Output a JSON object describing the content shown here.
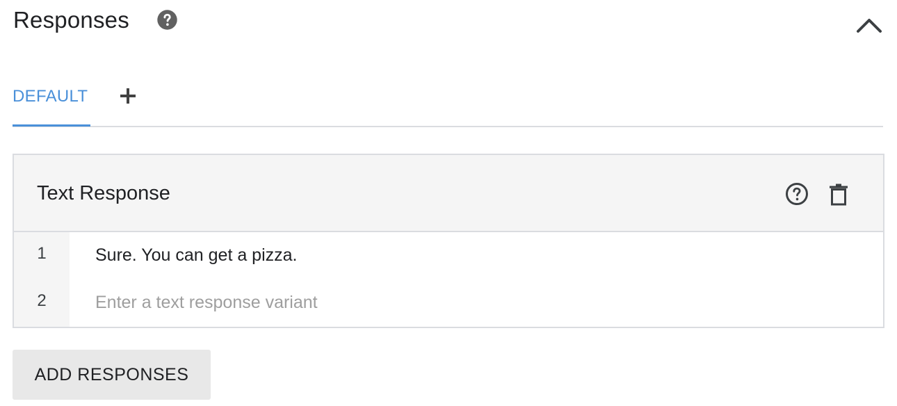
{
  "section": {
    "title": "Responses",
    "help_icon": "help-circle-icon",
    "collapse_icon": "chevron-up-icon"
  },
  "tabs": {
    "items": [
      {
        "label": "DEFAULT",
        "active": true
      }
    ],
    "add_icon": "plus-icon",
    "active_color": "#4a90d9"
  },
  "card": {
    "title": "Text Response",
    "help_icon": "help-circle-outline-icon",
    "delete_icon": "trash-icon",
    "rows": [
      {
        "number": "1",
        "value": "Sure. You can get a pizza.",
        "placeholder": ""
      },
      {
        "number": "2",
        "value": "",
        "placeholder": "Enter a text response variant"
      }
    ]
  },
  "add_button": {
    "label": "ADD RESPONSES"
  }
}
